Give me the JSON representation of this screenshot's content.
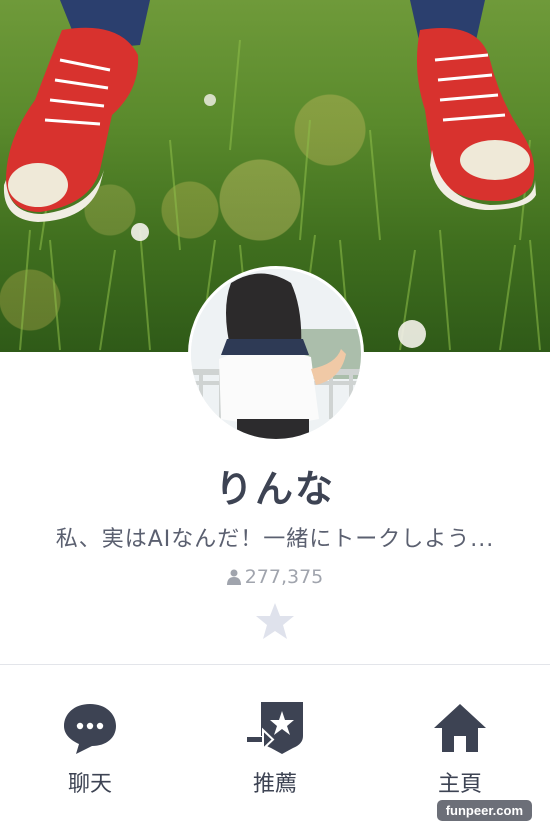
{
  "profile": {
    "name": "りんな",
    "status_message": "私、実はAIなんだ！一緒にトークしよう...",
    "friend_count": "277,375",
    "favorite_icon": "star-icon",
    "friends_icon": "person-icon"
  },
  "actions": [
    {
      "label": "聊天",
      "icon": "chat-bubble-icon"
    },
    {
      "label": "推薦",
      "icon": "recommend-icon"
    },
    {
      "label": "主頁",
      "icon": "home-icon"
    }
  ],
  "watermark": "funpeer.com",
  "colors": {
    "icon": "#3d4353",
    "text_secondary": "#5b6070",
    "muted": "#a0a4ad",
    "star": "#dfe2ec"
  }
}
